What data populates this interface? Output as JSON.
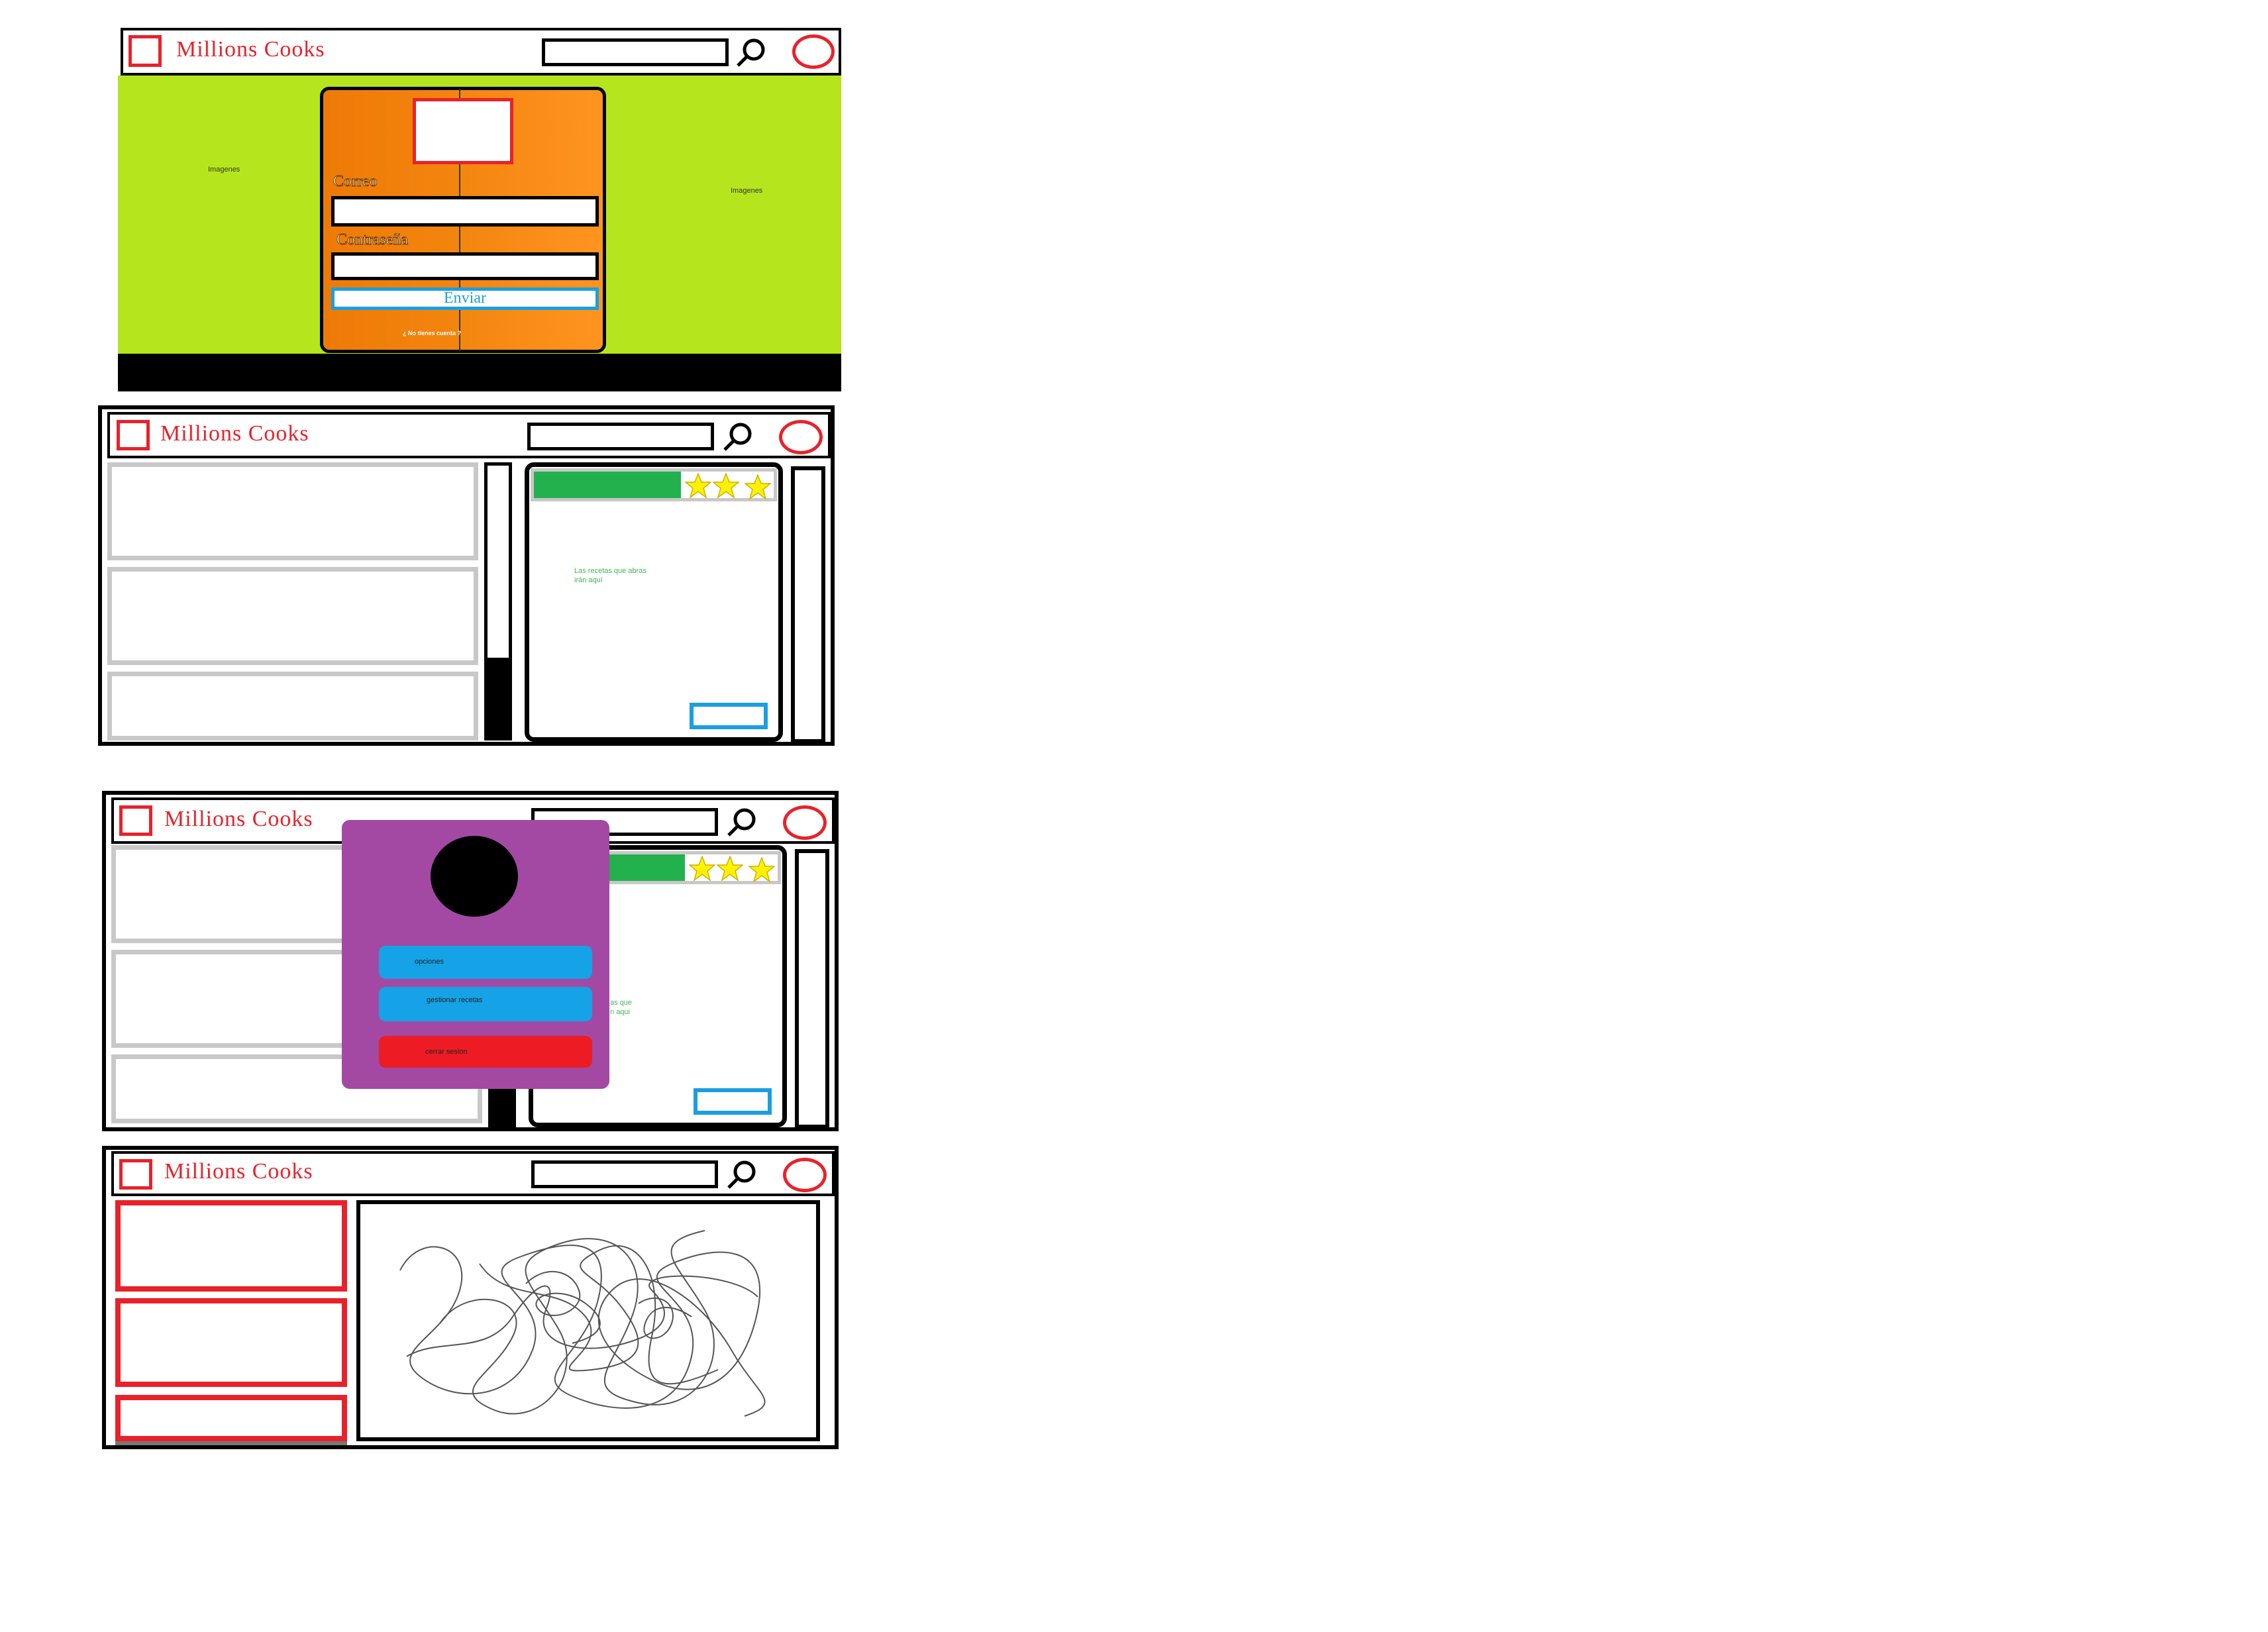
{
  "brand": "Millions Cooks",
  "login": {
    "image_left": "Imagenes",
    "image_right": "Imagenes",
    "email_label": "Correo",
    "password_label": "Contraseña",
    "submit_label": "Enviar",
    "footer_link": "¿ No tienes cuenta ?"
  },
  "recipes": {
    "note": "Las recetas que abras irán aquí",
    "stars_shown": 3
  },
  "menu": {
    "options_label": "opciones",
    "manage_label": "gestionar recetas",
    "logout_label": "cerrar sesion",
    "note_fragment": "as que\nn aqui"
  },
  "colors": {
    "brand_red": "#e8222b",
    "login_bg": "#b5e61d",
    "card_orange": "#f5820f",
    "accent_blue": "#1a9ee0",
    "green_bar": "#22b14c",
    "menu_purple": "#a349a4",
    "star_yellow": "#fff200"
  },
  "icons": [
    "logo-placeholder-icon",
    "search-icon",
    "user-avatar-icon",
    "star-icon"
  ]
}
